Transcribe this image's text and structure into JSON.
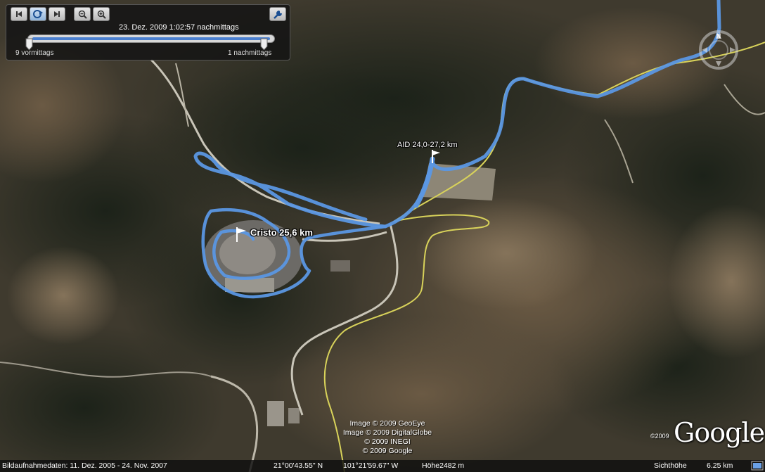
{
  "time_slider": {
    "date_time": "23. Dez. 2009   1:02:57 nachmittags",
    "start_label": "9 vormittags",
    "end_label": "1 nachmittags",
    "position_fraction": 1.0
  },
  "labels": {
    "aid": "AID 24,0-27,2 km",
    "cristo": "Cristo 25,6 km"
  },
  "compass": {
    "north": "N"
  },
  "copyright": {
    "line1": "Image © 2009 GeoEye",
    "line2": "Image © 2009 DigitalGlobe",
    "line3": "© 2009 INEGI",
    "line4": "© 2009 Google"
  },
  "branding": {
    "logo": "Google",
    "year": "©2009"
  },
  "status_bar": {
    "imagery_date": "Bildaufnahmedaten: 11. Dez. 2005 - 24. Nov. 2007",
    "latitude": "21°00'43.55\" N",
    "longitude": "101°21'59.67\" W",
    "elevation": "Höhe2482 m",
    "eye_alt_label": "Sichthöhe",
    "eye_alt_value": "6.25 km"
  },
  "colors": {
    "track": "#5b97e3",
    "road": "#d8d25a",
    "panel": "#141414"
  },
  "icons": [
    "skip-start-icon",
    "play-icon",
    "skip-end-icon",
    "zoom-out-icon",
    "zoom-in-icon",
    "wrench-icon",
    "flag-icon",
    "compass-icon"
  ]
}
